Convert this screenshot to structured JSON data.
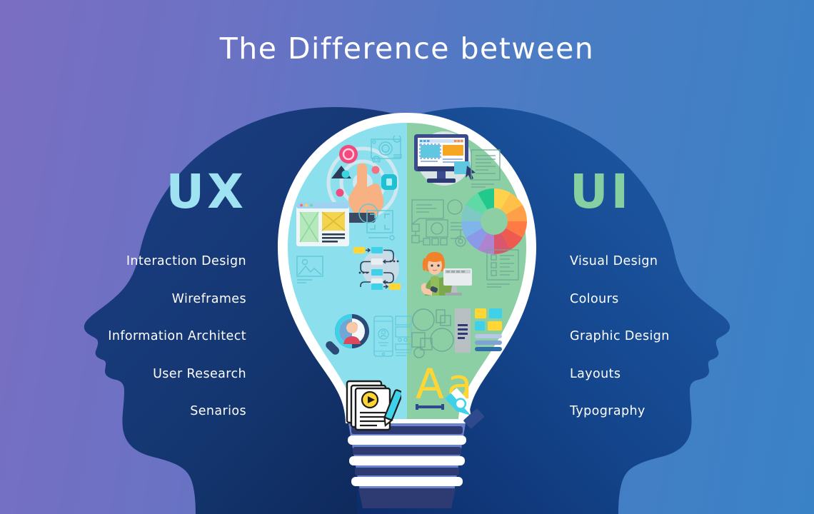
{
  "title": "The Difference between",
  "background": {
    "gradient_from": "#7a6ec2",
    "gradient_to": "#3a82c6"
  },
  "left_panel": {
    "heading": "UX",
    "heading_color": "#9fe3f2",
    "head_fill_from": "#1c3f86",
    "head_fill_to": "#0d2a5e",
    "items": [
      {
        "label": "Interaction Design"
      },
      {
        "label": "Wireframes"
      },
      {
        "label": "Information Architect"
      },
      {
        "label": "User Research"
      },
      {
        "label": "Senarios"
      }
    ]
  },
  "right_panel": {
    "heading": "UI",
    "heading_color": "#86cfa0",
    "head_fill_from": "#1c58a0",
    "head_fill_to": "#0f2f6d",
    "items": [
      {
        "label": "Visual Design"
      },
      {
        "label": "Colours"
      },
      {
        "label": "Graphic Design"
      },
      {
        "label": "Layouts"
      },
      {
        "label": "Typography"
      }
    ]
  },
  "bulb": {
    "left_half_color": "#8ce0ee",
    "right_half_color": "#8ccfa5",
    "outline_color": "#ffffff",
    "base_band_color": "#2e3b72",
    "left_icons": [
      "touch-interaction-icon",
      "camera-outline-icon",
      "browser-wireframe-icon",
      "crop-frame-outline-icon",
      "image-placeholder-outline-icon",
      "flowchart-icon",
      "magnifier-persona-icon",
      "mobile-desktop-wireframe-outline-icon",
      "scenario-documents-icon"
    ],
    "right_icons": [
      "design-monitor-icon",
      "text-document-outline-icon",
      "wireframe-schematic-outline-icon",
      "color-wheel-icon",
      "designer-at-computer-icon",
      "checklist-outline-icon",
      "ui-components-icon",
      "typography-pen-icon"
    ],
    "color_wheel": {
      "segments": [
        "#ffd24d",
        "#ffc04a",
        "#ffa64d",
        "#ff7a45",
        "#f4603c",
        "#e8544f",
        "#d9566b",
        "#b083d1",
        "#8a9ae8",
        "#7fb5e8",
        "#7fc9c4",
        "#5fd9a6"
      ]
    },
    "typography_sample": {
      "upper": "A",
      "lower": "a",
      "color": "#ffd633"
    }
  }
}
